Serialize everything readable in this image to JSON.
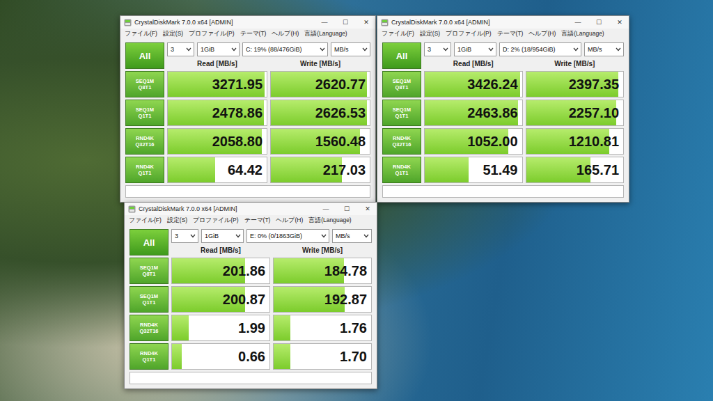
{
  "windows": [
    {
      "title": "CrystalDiskMark 7.0.0 x64 [ADMIN]",
      "title_controls": [
        "—",
        "☐",
        "✕"
      ],
      "menu": [
        "ファイル(F)",
        "設定(S)",
        "プロファイル(P)",
        "テーマ(T)",
        "ヘルプ(H)",
        "言語(Language)"
      ],
      "all_button": "All",
      "count": "3",
      "size": "1GiB",
      "drive": "C: 19% (88/476GiB)",
      "unit": "MB/s",
      "headers": [
        "Read [MB/s]",
        "Write [MB/s]"
      ],
      "rows": [
        {
          "label": "SEQ1M",
          "sub": "Q8T1",
          "read": {
            "value": "3271.95",
            "level": 0.98
          },
          "write": {
            "value": "2620.77",
            "level": 0.97
          }
        },
        {
          "label": "SEQ1M",
          "sub": "Q1T1",
          "read": {
            "value": "2478.86",
            "level": 0.97
          },
          "write": {
            "value": "2626.53",
            "level": 0.97
          }
        },
        {
          "label": "RND4K",
          "sub": "Q32T16",
          "read": {
            "value": "2058.80",
            "level": 0.95
          },
          "write": {
            "value": "1560.48",
            "level": 0.9
          }
        },
        {
          "label": "RND4K",
          "sub": "Q1T1",
          "read": {
            "value": "64.42",
            "level": 0.48
          },
          "write": {
            "value": "217.03",
            "level": 0.72
          }
        }
      ]
    },
    {
      "title": "CrystalDiskMark 7.0.0 x64 [ADMIN]",
      "title_controls": [
        "—",
        "☐",
        "✕"
      ],
      "menu": [
        "ファイル(F)",
        "設定(S)",
        "プロファイル(P)",
        "テーマ(T)",
        "ヘルプ(H)",
        "言語(Language)"
      ],
      "all_button": "All",
      "count": "3",
      "size": "1GiB",
      "drive": "D: 2% (18/954GiB)",
      "unit": "MB/s",
      "headers": [
        "Read [MB/s]",
        "Write [MB/s]"
      ],
      "rows": [
        {
          "label": "SEQ1M",
          "sub": "Q8T1",
          "read": {
            "value": "3426.24",
            "level": 0.98
          },
          "write": {
            "value": "2397.35",
            "level": 0.95
          }
        },
        {
          "label": "SEQ1M",
          "sub": "Q1T1",
          "read": {
            "value": "2463.86",
            "level": 0.96
          },
          "write": {
            "value": "2257.10",
            "level": 0.93
          }
        },
        {
          "label": "RND4K",
          "sub": "Q32T16",
          "read": {
            "value": "1052.00",
            "level": 0.86
          },
          "write": {
            "value": "1210.81",
            "level": 0.86
          }
        },
        {
          "label": "RND4K",
          "sub": "Q1T1",
          "read": {
            "value": "51.49",
            "level": 0.45
          },
          "write": {
            "value": "165.71",
            "level": 0.66
          }
        }
      ]
    },
    {
      "title": "CrystalDiskMark 7.0.0 x64 [ADMIN]",
      "title_controls": [
        "—",
        "☐",
        "✕"
      ],
      "menu": [
        "ファイル(F)",
        "設定(S)",
        "プロファイル(P)",
        "テーマ(T)",
        "ヘルプ(H)",
        "言語(Language)"
      ],
      "all_button": "All",
      "count": "3",
      "size": "1GiB",
      "drive": "E: 0% (0/1863GiB)",
      "unit": "MB/s",
      "headers": [
        "Read [MB/s]",
        "Write [MB/s]"
      ],
      "rows": [
        {
          "label": "SEQ1M",
          "sub": "Q8T1",
          "read": {
            "value": "201.86",
            "level": 0.75
          },
          "write": {
            "value": "184.78",
            "level": 0.72
          }
        },
        {
          "label": "SEQ1M",
          "sub": "Q1T1",
          "read": {
            "value": "200.87",
            "level": 0.75
          },
          "write": {
            "value": "192.87",
            "level": 0.73
          }
        },
        {
          "label": "RND4K",
          "sub": "Q32T16",
          "read": {
            "value": "1.99",
            "level": 0.17
          },
          "write": {
            "value": "1.76",
            "level": 0.17
          }
        },
        {
          "label": "RND4K",
          "sub": "Q1T1",
          "read": {
            "value": "0.66",
            "level": 0.1
          },
          "write": {
            "value": "1.70",
            "level": 0.17
          }
        }
      ]
    }
  ]
}
